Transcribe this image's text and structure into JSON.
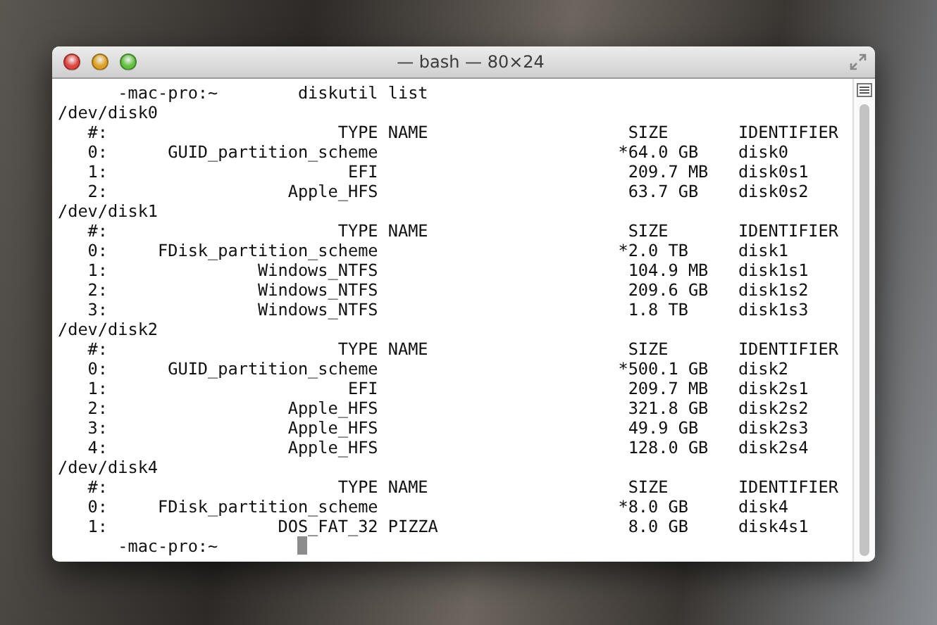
{
  "window": {
    "title": "— bash — 80×24"
  },
  "terminal": {
    "cursor_visible": true,
    "lines": [
      "      -mac-pro:~        diskutil list",
      "/dev/disk0",
      "   #:                       TYPE NAME                    SIZE       IDENTIFIER",
      "   0:      GUID_partition_scheme                        *64.0 GB    disk0",
      "   1:                        EFI                         209.7 MB   disk0s1",
      "   2:                  Apple_HFS                         63.7 GB    disk0s2",
      "/dev/disk1",
      "   #:                       TYPE NAME                    SIZE       IDENTIFIER",
      "   0:     FDisk_partition_scheme                        *2.0 TB     disk1",
      "   1:               Windows_NTFS                         104.9 MB   disk1s1",
      "   2:               Windows_NTFS                         209.6 GB   disk1s2",
      "   3:               Windows_NTFS                         1.8 TB     disk1s3",
      "/dev/disk2",
      "   #:                       TYPE NAME                    SIZE       IDENTIFIER",
      "   0:      GUID_partition_scheme                        *500.1 GB   disk2",
      "   1:                        EFI                         209.7 MB   disk2s1",
      "   2:                  Apple_HFS                         321.8 GB   disk2s2",
      "   3:                  Apple_HFS                         49.9 GB    disk2s3",
      "   4:                  Apple_HFS                         128.0 GB   disk2s4",
      "/dev/disk4",
      "   #:                       TYPE NAME                    SIZE       IDENTIFIER",
      "   0:     FDisk_partition_scheme                        *8.0 GB     disk4",
      "   1:                 DOS_FAT_32 PIZZA                   8.0 GB     disk4s1",
      "      -mac-pro:~"
    ]
  }
}
